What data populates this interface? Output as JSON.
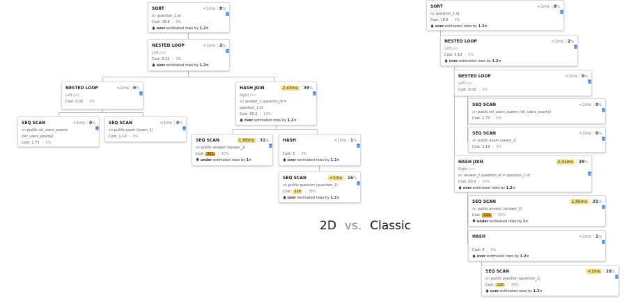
{
  "caption": {
    "left": "2D",
    "vs": "vs.",
    "right": "Classic"
  },
  "labels": {
    "cost": "Cost:",
    "estimated_suffix": "estimated rows by"
  },
  "nodes": {
    "sort": {
      "name": "SORT",
      "time": "<1ms",
      "time_hl": false,
      "pct": "8",
      "line1_label": "by",
      "line1_value": "question_1.id",
      "cost": "18.8",
      "cost_pct": "3%",
      "est_dir": "over",
      "est_arrow": "🡅",
      "est_factor": "1.2×"
    },
    "nl1": {
      "name": "NESTED LOOP",
      "time": "<1ms",
      "time_hl": false,
      "pct": "2",
      "line1_label": "Left",
      "line1_value": "Join",
      "cost": "5.12",
      "cost_pct": "1%",
      "est_dir": "over",
      "est_arrow": "🡅",
      "est_factor": "1.2×"
    },
    "nl2": {
      "name": "NESTED LOOP",
      "time": "<1ms",
      "time_hl": false,
      "pct": "0",
      "line1_label": "Left",
      "line1_value": "Join",
      "cost": "0.02",
      "cost_pct": "0%"
    },
    "seq_rue": {
      "name": "SEQ SCAN",
      "time": "<1ms",
      "time_hl": false,
      "pct": "0",
      "line1_label": "on",
      "line1_value": "public.rel_users_exams (rel_users_exams)",
      "cost": "1.73",
      "cost_pct": "0%"
    },
    "seq_exam": {
      "name": "SEQ SCAN",
      "time": "<1ms",
      "time_hl": false,
      "pct": "0",
      "line1_label": "on",
      "line1_value": "public.exam (exam_1)",
      "cost": "1.19",
      "cost_pct": "0%"
    },
    "hashjoin": {
      "name": "HASH JOIN",
      "time": "2,43ms",
      "time_hl": true,
      "pct": "39",
      "line1_label": "Right",
      "line1_value": "Join",
      "line2_label": "on",
      "line2_value": "answer_1.question_id = question_1.id",
      "cost": "60.2",
      "cost_pct": "10%",
      "est_dir": "over",
      "est_arrow": "🡅",
      "est_factor": "1.2×"
    },
    "seq_answer": {
      "name": "SEQ SCAN",
      "time": "1,96ms",
      "time_hl": true,
      "pct": "31",
      "line1_label": "on",
      "line1_value": "public.answer (answer_1)",
      "cost": "311",
      "cost_badge": "orange",
      "cost_pct": "50%",
      "est_dir": "under",
      "est_arrow": "🡇",
      "est_factor": "1×"
    },
    "hash": {
      "name": "HASH",
      "time": "<1ms",
      "time_hl": false,
      "pct": "1",
      "cost": "0",
      "cost_pct": "0%",
      "est_dir": "over",
      "est_arrow": "🡅",
      "est_factor": "1.2×"
    },
    "seq_question": {
      "name": "SEQ SCAN",
      "time": "<1ms",
      "time_hl": true,
      "pct": "16",
      "line1_label": "on",
      "line1_value": "public.question (question_1)",
      "cost": "228",
      "cost_badge": "yellow",
      "cost_pct": "36%",
      "est_dir": "over",
      "est_arrow": "🡅",
      "est_factor": "1.2×"
    }
  }
}
